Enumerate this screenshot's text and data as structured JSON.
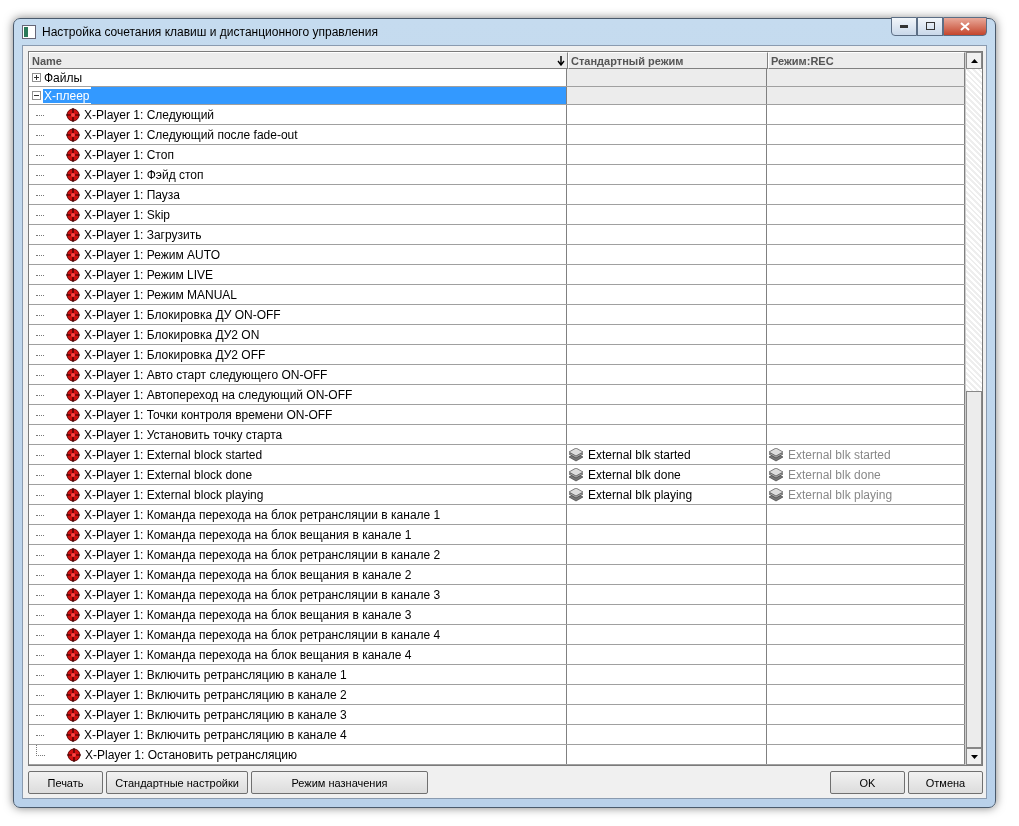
{
  "window": {
    "title": "Настройка сочетания клавиш и дистанционного управления"
  },
  "table": {
    "columns": [
      "Name",
      "Стандартный режим",
      "Режим:REC"
    ],
    "groups": [
      {
        "label": "Файлы",
        "expanded": false,
        "selected": false
      },
      {
        "label": "Х-плеер",
        "expanded": true,
        "selected": true,
        "children": [
          {
            "name": "X-Player 1: Следующий"
          },
          {
            "name": "X-Player 1: Следующий после fade-out"
          },
          {
            "name": "X-Player 1: Стоп"
          },
          {
            "name": "X-Player 1: Фэйд стоп"
          },
          {
            "name": "X-Player 1: Пауза"
          },
          {
            "name": "X-Player 1: Skip"
          },
          {
            "name": "X-Player 1: Загрузить"
          },
          {
            "name": "X-Player 1: Режим AUTO"
          },
          {
            "name": "X-Player 1: Режим LIVE"
          },
          {
            "name": "X-Player 1: Режим MANUAL"
          },
          {
            "name": "X-Player 1: Блокировка ДУ ON-OFF"
          },
          {
            "name": "X-Player 1: Блокировка ДУ2 ON"
          },
          {
            "name": "X-Player 1: Блокировка ДУ2 OFF"
          },
          {
            "name": "X-Player 1: Авто старт следующего ON-OFF"
          },
          {
            "name": "X-Player 1: Автопереход на следующий  ON-OFF"
          },
          {
            "name": "X-Player 1: Точки контроля времени  ON-OFF"
          },
          {
            "name": "X-Player 1: Установить точку старта"
          },
          {
            "name": "X-Player 1: External block started",
            "standard": "External blk started",
            "rec": "External blk started"
          },
          {
            "name": "X-Player 1: External block done",
            "standard": "External blk done",
            "rec": "External blk done"
          },
          {
            "name": "X-Player 1: External block playing",
            "standard": "External blk playing",
            "rec": "External blk playing"
          },
          {
            "name": "X-Player 1: Команда перехода на блок ретрансляции в канале 1"
          },
          {
            "name": "X-Player 1: Команда перехода на блок вещания в канале 1"
          },
          {
            "name": "X-Player 1: Команда перехода на блок ретрансляции в канале 2"
          },
          {
            "name": "X-Player 1: Команда перехода на блок вещания в канале 2"
          },
          {
            "name": "X-Player 1: Команда перехода на блок ретрансляции в канале 3"
          },
          {
            "name": "X-Player 1: Команда перехода на блок вещания в канале 3"
          },
          {
            "name": "X-Player 1: Команда перехода на блок ретрансляции в канале 4"
          },
          {
            "name": "X-Player 1: Команда перехода на блок вещания в канале 4"
          },
          {
            "name": "X-Player 1: Включить ретрансляцию в канале 1"
          },
          {
            "name": "X-Player 1: Включить ретрансляцию в канале 2"
          },
          {
            "name": "X-Player 1: Включить ретрансляцию в канале 3"
          },
          {
            "name": "X-Player 1: Включить ретрансляцию в канале 4"
          },
          {
            "name": "X-Player 1: Остановить ретрансляцию"
          }
        ]
      }
    ]
  },
  "buttons_left": [
    "Печать",
    "Стандартные настройки",
    "Режим назначения"
  ],
  "buttons_right": [
    "OK",
    "Отмена"
  ]
}
